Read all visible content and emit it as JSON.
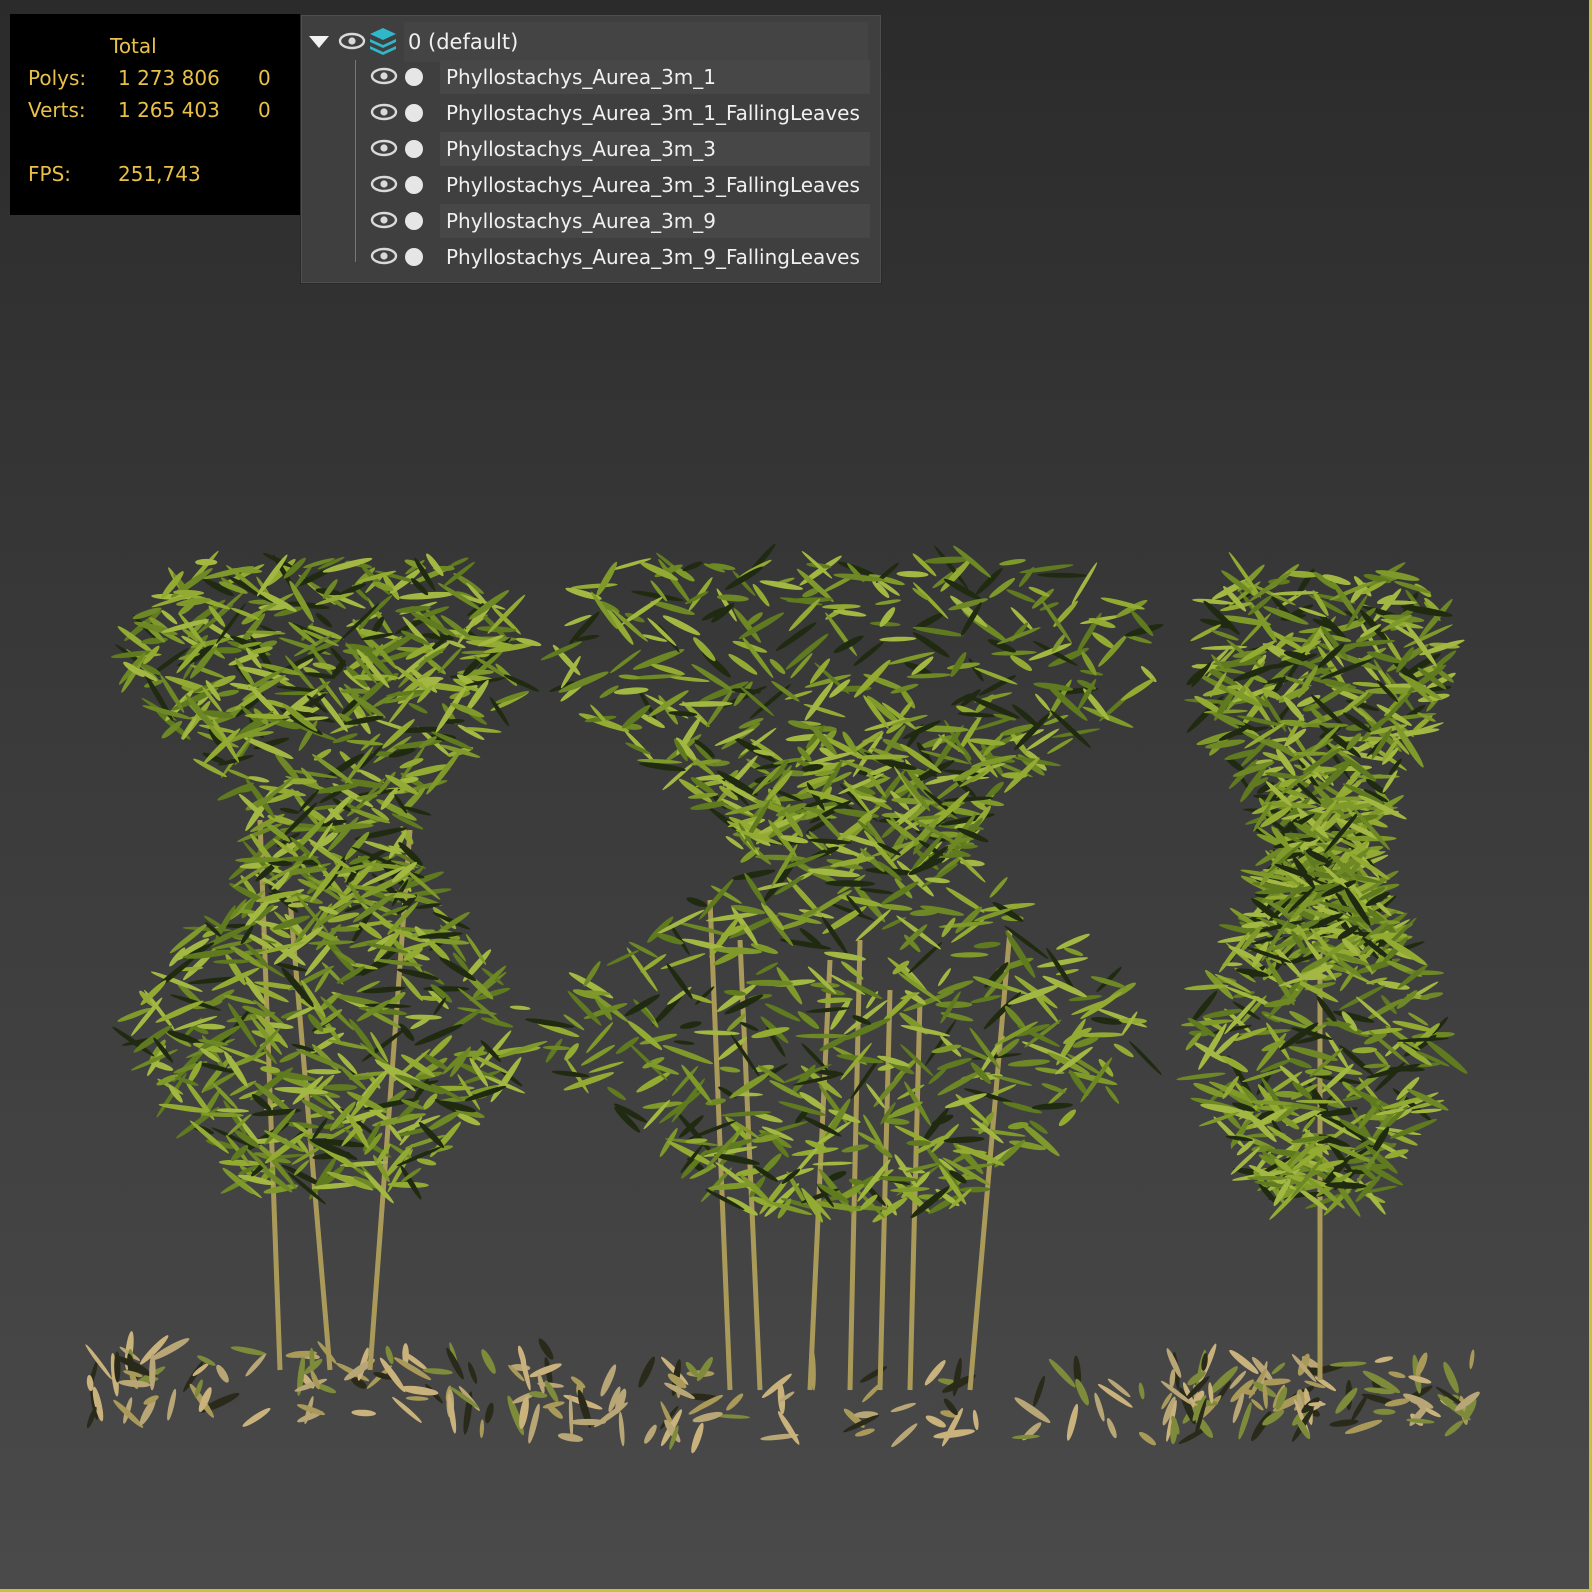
{
  "stats": {
    "header": "Total",
    "polys_label": "Polys:",
    "polys_total": "1 273 806",
    "polys_selected": "0",
    "verts_label": "Verts:",
    "verts_total": "1 265 403",
    "verts_selected": "0",
    "fps_label": "FPS:",
    "fps_value": "251,743",
    "text_color": "#e8c04a"
  },
  "layer_explorer": {
    "root": {
      "label": "0 (default)",
      "expanded": true,
      "icons": [
        "collapse-triangle-icon",
        "eye-icon",
        "layer-stack-icon"
      ]
    },
    "items": [
      {
        "label": "Phyllostachys_Aurea_3m_1"
      },
      {
        "label": "Phyllostachys_Aurea_3m_1_FallingLeaves"
      },
      {
        "label": "Phyllostachys_Aurea_3m_3"
      },
      {
        "label": "Phyllostachys_Aurea_3m_3_FallingLeaves"
      },
      {
        "label": "Phyllostachys_Aurea_3m_9"
      },
      {
        "label": "Phyllostachys_Aurea_3m_9_FallingLeaves"
      }
    ],
    "accent_color": "#2fb8c9"
  },
  "viewport": {
    "border_color": "#c7c23a",
    "foliage_color": "#7f9a2a",
    "stem_color": "#a99a5a"
  }
}
